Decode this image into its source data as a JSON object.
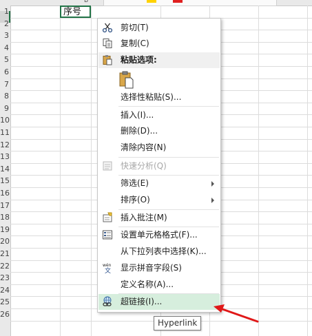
{
  "sheet": {
    "header_cell_text": "序号",
    "column_letters": [
      "B"
    ],
    "row_numbers": [
      "1",
      "2",
      "3",
      "4",
      "5",
      "6",
      "7",
      "8",
      "9",
      "10",
      "11",
      "12",
      "13",
      "14",
      "15",
      "16",
      "17",
      "18",
      "19",
      "20",
      "21",
      "22",
      "23",
      "24",
      "25",
      "26"
    ]
  },
  "menu": {
    "cut": "剪切(T)",
    "copy": "复制(C)",
    "paste_options": "粘贴选项:",
    "paste_special": "选择性粘贴(S)...",
    "insert": "插入(I)...",
    "delete": "删除(D)...",
    "clear_contents": "清除内容(N)",
    "quick_analysis": "快速分析(Q)",
    "filter": "筛选(E)",
    "sort": "排序(O)",
    "insert_comment": "插入批注(M)",
    "format_cells": "设置单元格格式(F)...",
    "pick_from_list": "从下拉列表中选择(K)...",
    "show_phonetic": "显示拼音字段(S)",
    "define_name": "定义名称(A)...",
    "hyperlink": "超链接(I)..."
  },
  "tooltip": {
    "text": "Hyperlink"
  },
  "colors": {
    "selection_green": "#217346",
    "hover_green": "#d6eedd",
    "annotation_red": "#e01818"
  }
}
